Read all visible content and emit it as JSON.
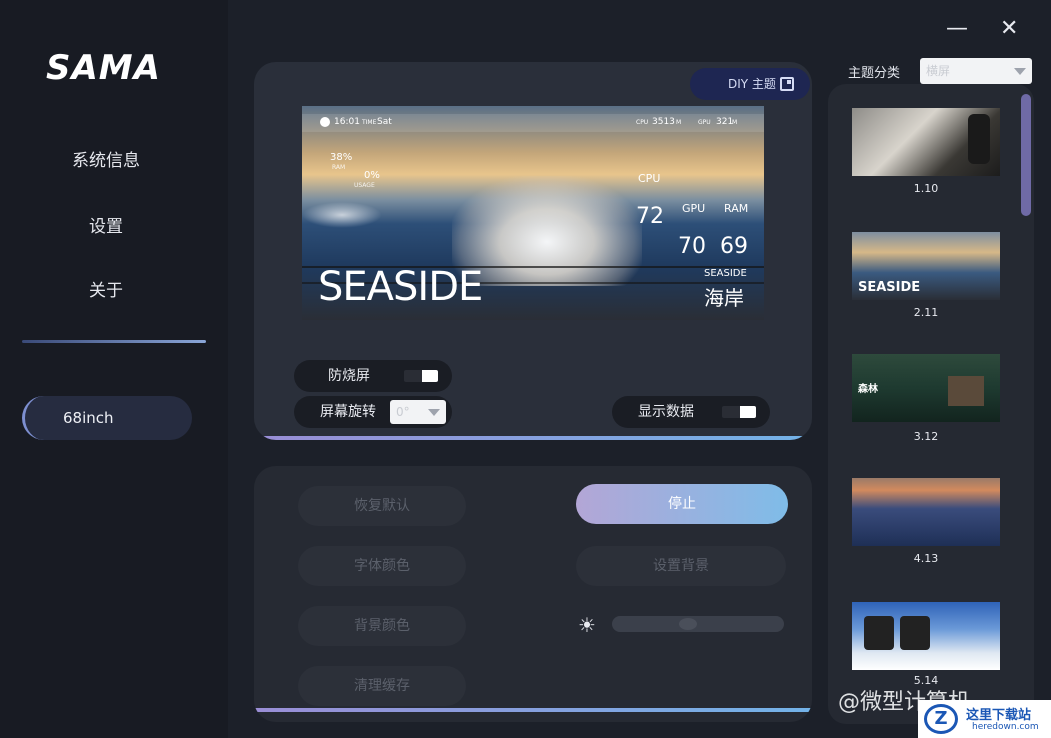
{
  "brand": {
    "logo_text": "SAMA"
  },
  "sidebar": {
    "items": [
      {
        "label": "系统信息"
      },
      {
        "label": "设置"
      },
      {
        "label": "关于"
      }
    ],
    "device": {
      "label": "68inch"
    }
  },
  "window": {
    "minimize": "—",
    "close": "✕"
  },
  "preview_panel": {
    "diy_label": "DIY 主题",
    "screen": {
      "time": "16:01",
      "time_label": "TIME",
      "day": "Sat",
      "cpu_freq_label": "CPU",
      "cpu_freq": "3513",
      "cpu_freq_unit": "M",
      "gpu_freq_label": "GPU",
      "gpu_freq": "321",
      "gpu_freq_unit": "M",
      "ram_pct": "38%",
      "ram_label": "RAM",
      "usage_pct": "0%",
      "usage_label": "USAGE",
      "cpu_label": "CPU",
      "cpu_temp": "72",
      "gpu_label": "GPU",
      "gpu_temp": "70",
      "ram_temp_label": "RAM",
      "ram_temp": "69",
      "title_en": "SEASIDE",
      "title_small": "SEASIDE",
      "title_cn": "海岸"
    },
    "burn_in_label": "防烧屏",
    "rotate_label": "屏幕旋转",
    "rotate_value": "0°",
    "show_data_label": "显示数据"
  },
  "controls": {
    "restore_default": "恢复默认",
    "stop": "停止",
    "font_color": "字体颜色",
    "set_background": "设置背景",
    "background_color": "背景颜色",
    "clear_cache": "清理缓存",
    "brightness": 0.43,
    "brightness_icon": "sun-icon"
  },
  "theme_category": {
    "label": "主题分类",
    "value": "横屏"
  },
  "themes": [
    {
      "label": "1.10"
    },
    {
      "label": "2.11",
      "text": "SEASIDE"
    },
    {
      "label": "3.12",
      "text": "森林"
    },
    {
      "label": "4.13"
    },
    {
      "label": "5.14"
    }
  ],
  "watermark": {
    "text": "@微型计算机",
    "site_cn": "这里下载站",
    "site_en": "heredown.com"
  }
}
